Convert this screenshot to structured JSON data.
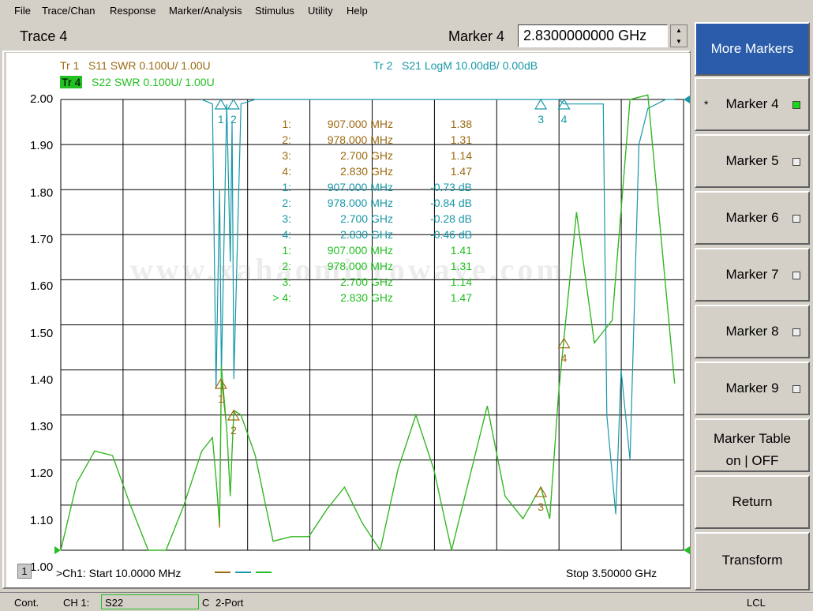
{
  "menu": [
    "File",
    "Trace/Chan",
    "Response",
    "Marker/Analysis",
    "Stimulus",
    "Utility",
    "Help"
  ],
  "toolbar": {
    "trace_title": "Trace 4",
    "marker_label": "Marker 4",
    "marker_value": "2.8300000000 GHz",
    "spin_up_icon": "up-triangle",
    "spin_down_icon": "down-triangle"
  },
  "traces": {
    "tr1": {
      "label": "Tr  1",
      "desc": "S11 SWR 0.100U/  1.00U",
      "color": "#9c6a10"
    },
    "tr2": {
      "label": "Tr  2",
      "desc": "S21 LogM 10.00dB/  0.00dB",
      "color": "#1898a8"
    },
    "tr4": {
      "label": "Tr  4",
      "desc": "S22 SWR 0.100U/  1.00U",
      "color": "#22c022",
      "active_bg": "#22c022"
    }
  },
  "y_axis": {
    "ticks": [
      "2.00",
      "1.90",
      "1.80",
      "1.70",
      "1.60",
      "1.50",
      "1.40",
      "1.30",
      "1.20",
      "1.10",
      "1.00"
    ]
  },
  "marker_table": [
    {
      "num": "1:",
      "freq": "907.000 MHz",
      "val": "1.38",
      "trace": "tr1"
    },
    {
      "num": "2:",
      "freq": "978.000 MHz",
      "val": "1.31",
      "trace": "tr1"
    },
    {
      "num": "3:",
      "freq": "2.700 GHz",
      "val": "1.14",
      "trace": "tr1"
    },
    {
      "num": "4:",
      "freq": "2.830 GHz",
      "val": "1.47",
      "trace": "tr1"
    },
    {
      "num": "1:",
      "freq": "907.000 MHz",
      "val": "-0.73 dB",
      "trace": "tr2"
    },
    {
      "num": "2:",
      "freq": "978.000 MHz",
      "val": "-0.84 dB",
      "trace": "tr2"
    },
    {
      "num": "3:",
      "freq": "2.700 GHz",
      "val": "-0.28 dB",
      "trace": "tr2"
    },
    {
      "num": "4:",
      "freq": "2.830 GHz",
      "val": "-0.46 dB",
      "trace": "tr2"
    },
    {
      "num": "1:",
      "freq": "907.000 MHz",
      "val": "1.41",
      "trace": "tr4"
    },
    {
      "num": "2:",
      "freq": "978.000 MHz",
      "val": "1.31",
      "trace": "tr4"
    },
    {
      "num": "3:",
      "freq": "2.700 GHz",
      "val": "1.14",
      "trace": "tr4"
    },
    {
      "num": "> 4:",
      "freq": "2.830 GHz",
      "val": "1.47",
      "trace": "tr4"
    }
  ],
  "watermark": "www.xahaomicrowave.com",
  "footer": {
    "channel_badge": "1",
    "start": ">Ch1: Start  10.0000 MHz",
    "stop": "Stop  3.50000 GHz"
  },
  "status": {
    "mode": "Cont.",
    "channel": "CH 1:",
    "sparam": "S22",
    "cal": "C",
    "port": "2-Port",
    "remote": "LCL"
  },
  "softkeys": [
    {
      "label": "More Markers",
      "primary": true
    },
    {
      "label": "Marker 4",
      "led": true,
      "led_on": true,
      "star": "*"
    },
    {
      "label": "Marker 5",
      "led": true
    },
    {
      "label": "Marker 6",
      "led": true
    },
    {
      "label": "Marker 7",
      "led": true
    },
    {
      "label": "Marker 8",
      "led": true
    },
    {
      "label": "Marker 9",
      "led": true
    },
    {
      "label": "Marker Table",
      "label2": "on | OFF"
    },
    {
      "label": "Return"
    },
    {
      "label": "Transform"
    }
  ],
  "chart_data": {
    "type": "line",
    "x_unit": "GHz",
    "xlim": [
      0.01,
      3.5
    ],
    "ylim": [
      1.0,
      2.0
    ],
    "grid": true,
    "series": [
      {
        "name": "S11 SWR",
        "color": "#9c6a10",
        "x": [
          0.01,
          0.1,
          0.2,
          0.3,
          0.4,
          0.5,
          0.6,
          0.7,
          0.8,
          0.86,
          0.88,
          0.9,
          0.91,
          0.94,
          0.96,
          0.97,
          0.98,
          1.02,
          1.1,
          1.2,
          1.3,
          1.4,
          1.5,
          1.6,
          1.7,
          1.8,
          1.9,
          2.0,
          2.1,
          2.2,
          2.3,
          2.4,
          2.5,
          2.6,
          2.7,
          2.75,
          2.8,
          2.83,
          2.9,
          3.0,
          3.1,
          3.2,
          3.3,
          3.45
        ],
        "y": [
          1.0,
          1.15,
          1.22,
          1.21,
          1.1,
          1.0,
          1.0,
          1.1,
          1.22,
          1.25,
          1.16,
          1.05,
          1.38,
          1.27,
          1.12,
          1.22,
          1.31,
          1.3,
          1.21,
          1.02,
          1.03,
          1.03,
          1.09,
          1.14,
          1.06,
          1.0,
          1.18,
          1.3,
          1.18,
          1.0,
          1.16,
          1.32,
          1.12,
          1.07,
          1.14,
          1.07,
          1.35,
          1.47,
          1.75,
          1.46,
          1.51,
          2.0,
          2.01,
          1.37
        ]
      },
      {
        "name": "S21 LogM",
        "color": "#1898a8",
        "x": [
          0.8,
          0.86,
          0.88,
          0.9,
          0.91,
          0.94,
          0.96,
          0.97,
          0.98,
          1.02,
          1.1,
          1.3,
          2.0,
          2.6,
          2.7,
          2.8,
          2.83,
          3.0,
          3.05,
          3.07,
          3.12,
          3.15,
          3.2,
          3.25,
          3.3,
          3.4,
          3.45
        ],
        "y": [
          2.0,
          1.99,
          1.36,
          1.8,
          1.39,
          1.99,
          1.64,
          1.95,
          1.38,
          1.99,
          2.0,
          2.0,
          2.0,
          2.0,
          2.0,
          2.0,
          1.99,
          1.99,
          1.99,
          1.3,
          1.08,
          1.4,
          1.2,
          1.9,
          1.98,
          2.0,
          2.0
        ]
      },
      {
        "name": "S22 SWR",
        "color": "#22c022",
        "x": [
          0.01,
          0.1,
          0.2,
          0.3,
          0.4,
          0.5,
          0.6,
          0.7,
          0.8,
          0.86,
          0.88,
          0.9,
          0.91,
          0.94,
          0.96,
          0.97,
          0.98,
          1.02,
          1.1,
          1.2,
          1.3,
          1.4,
          1.5,
          1.6,
          1.7,
          1.8,
          1.9,
          2.0,
          2.1,
          2.2,
          2.3,
          2.4,
          2.5,
          2.6,
          2.7,
          2.75,
          2.8,
          2.83,
          2.9,
          3.0,
          3.1,
          3.2,
          3.3,
          3.45
        ],
        "y": [
          1.0,
          1.15,
          1.22,
          1.21,
          1.1,
          1.0,
          1.0,
          1.1,
          1.22,
          1.25,
          1.16,
          1.06,
          1.41,
          1.27,
          1.12,
          1.22,
          1.31,
          1.3,
          1.21,
          1.02,
          1.03,
          1.03,
          1.09,
          1.14,
          1.06,
          1.0,
          1.18,
          1.3,
          1.18,
          1.0,
          1.16,
          1.32,
          1.12,
          1.07,
          1.14,
          1.07,
          1.35,
          1.47,
          1.75,
          1.46,
          1.51,
          2.0,
          2.01,
          1.37
        ]
      }
    ],
    "markers": [
      {
        "num": "1",
        "x": 0.907,
        "y": 1.38,
        "series": "S11 SWR"
      },
      {
        "num": "2",
        "x": 0.978,
        "y": 1.31,
        "series": "S11 SWR"
      },
      {
        "num": "3",
        "x": 2.7,
        "y": 1.14,
        "series": "S11 SWR"
      },
      {
        "num": "4",
        "x": 2.83,
        "y": 1.47,
        "series": "S11 SWR"
      },
      {
        "num": "1",
        "x": 0.907,
        "y": 2.0,
        "series": "S21 LogM"
      },
      {
        "num": "2",
        "x": 0.978,
        "y": 2.0,
        "series": "S21 LogM"
      },
      {
        "num": "3",
        "x": 2.7,
        "y": 2.0,
        "series": "S21 LogM"
      },
      {
        "num": "4",
        "x": 2.83,
        "y": 2.0,
        "series": "S21 LogM"
      }
    ]
  }
}
